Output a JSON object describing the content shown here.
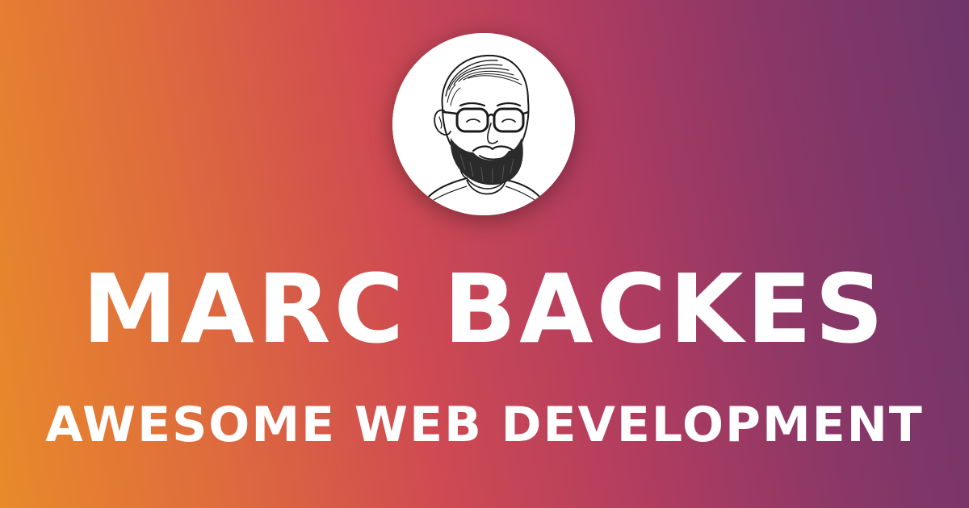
{
  "header": {
    "name": "MARC BACKES",
    "tagline": "AWESOME WEB DEVELOPMENT"
  },
  "avatar": {
    "icon": "sketch-portrait-illustration"
  },
  "colors": {
    "gradient_start": "#e88a2a",
    "gradient_mid": "#cf4a52",
    "gradient_end": "#6e356a",
    "text": "#ffffff",
    "avatar_bg": "#ffffff"
  }
}
